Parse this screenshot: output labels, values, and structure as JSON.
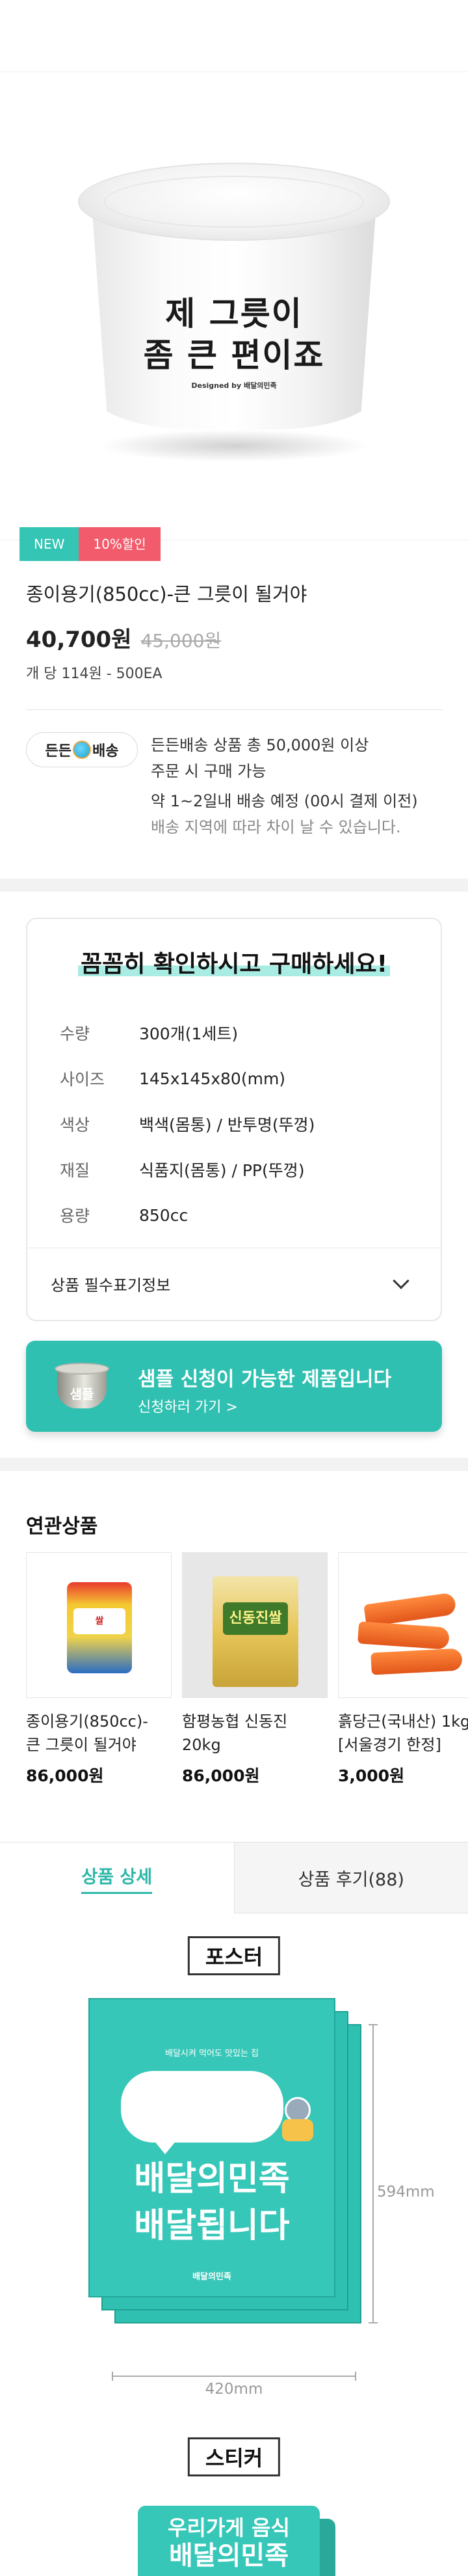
{
  "product": {
    "image_text_line1": "제 그릇이",
    "image_text_line2": "좀 큰 편이죠",
    "image_text_line3": "Designed by 배달의민족",
    "badge_new": "NEW",
    "badge_sale": "10%할인",
    "title": "종이용기(850cc)-큰 그릇이 될거야",
    "price": "40,700원",
    "original_price": "45,000원",
    "unit_info": "개 당 114원 - 500EA"
  },
  "shipping": {
    "badge_prefix": "든든",
    "badge_suffix": "배송",
    "line1": "든든배송 상품 총 50,000원 이상",
    "line2": "주문 시 구매 가능",
    "line3": "약 1~2일내 배송 예정 (00시 결제 이전)",
    "line4": "배송 지역에 따라 차이 날 수 있습니다."
  },
  "check_card": {
    "title": "꼼꼼히 확인하시고 구매하세요!",
    "specs": [
      {
        "label": "수량",
        "value": "300개(1세트)"
      },
      {
        "label": "사이즈",
        "value": "145x145x80(mm)"
      },
      {
        "label": "색상",
        "value": "백색(몸통) / 반투명(뚜껑)"
      },
      {
        "label": "재질",
        "value": "식품지(몸통) / PP(뚜껑)"
      },
      {
        "label": "용량",
        "value": "850cc"
      }
    ],
    "more_info": "상품 필수표기정보"
  },
  "sample": {
    "icon_label": "샘플",
    "title": "샘플 신청이 가능한 제품입니다",
    "link": "신청하러 가기 >"
  },
  "related": {
    "title": "연관상품",
    "items": [
      {
        "name_line1": "종이용기(850cc)-",
        "name_line2": "큰 그릇이 될거야",
        "price": "86,000원",
        "thumb_label": "쌀"
      },
      {
        "name_line1": "함평농협 신동진",
        "name_line2": "20kg",
        "price": "86,000원",
        "thumb_label": "신동진쌀"
      },
      {
        "name_line1": "흙당근(국내산) 1kg",
        "name_line2": "[서울경기 한정]",
        "price": "3,000원",
        "thumb_label": ""
      }
    ]
  },
  "tabs": {
    "detail": "상품 상세",
    "reviews": "상품 후기(88)"
  },
  "detail": {
    "poster_label": "포스터",
    "poster_small": "배달시켜 먹어도 맛있는 집",
    "poster_line1": "배달의민족",
    "poster_line2": "배달됩니다",
    "poster_logo": "배달의민족",
    "height_dim": "594mm",
    "width_dim": "420mm",
    "sticker_label": "스티커",
    "sticker_line1": "우리가게 음식",
    "sticker_line2": "배달의민족"
  },
  "colors": {
    "accent": "#35c5b4",
    "sale": "#f25b6b"
  }
}
